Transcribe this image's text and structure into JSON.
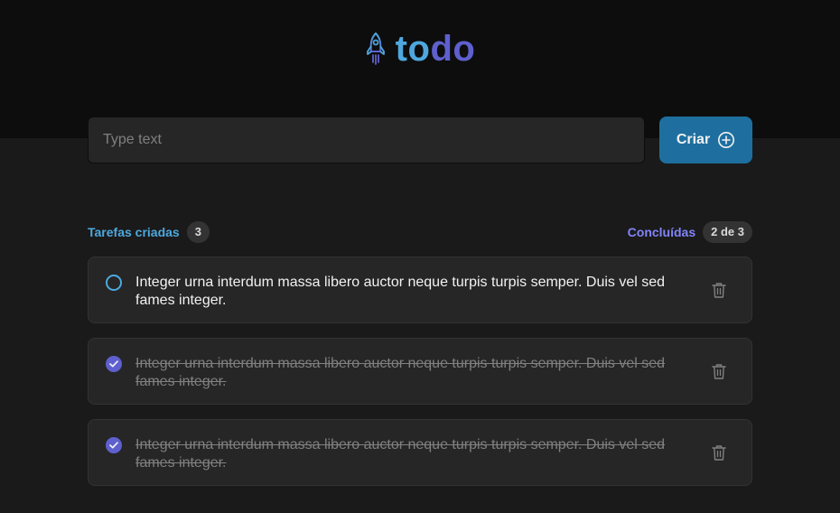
{
  "app": {
    "logo_part1": "to",
    "logo_part2": "do",
    "colors": {
      "blue": "#4ea8de",
      "purple": "#5e60ce",
      "button": "#1e6f9f"
    }
  },
  "new_task": {
    "placeholder": "Type text",
    "create_label": "Criar",
    "create_icon": "plus-circle-icon"
  },
  "counters": {
    "created_label": "Tarefas criadas",
    "created_count": "3",
    "done_label": "Concluídas",
    "done_count": "2 de 3"
  },
  "tasks": [
    {
      "text": "Integer urna interdum massa libero auctor neque turpis turpis semper. Duis vel sed fames integer.",
      "completed": false
    },
    {
      "text": "Integer urna interdum massa libero auctor neque turpis turpis semper. Duis vel sed fames integer.",
      "completed": true
    },
    {
      "text": "Integer urna interdum massa libero auctor neque turpis turpis semper. Duis vel sed fames integer.",
      "completed": true
    }
  ]
}
